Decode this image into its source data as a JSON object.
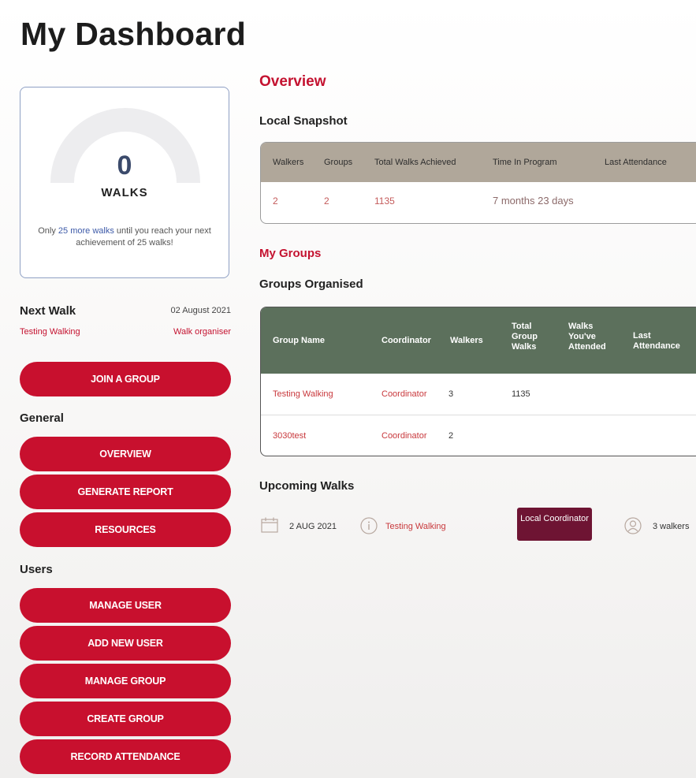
{
  "page": {
    "title": "My Dashboard"
  },
  "achievement": {
    "count": "0",
    "unit": "WALKS",
    "message_prefix": "Only ",
    "message_highlight": "25 more walks",
    "message_suffix": " until you reach your next achievement of 25 walks!",
    "progress": 0
  },
  "next_walk": {
    "title": "Next Walk",
    "date": "02 August 2021",
    "group": "Testing Walking",
    "role": "Walk organiser"
  },
  "sidebar": {
    "join_label": "JOIN A GROUP",
    "general_label": "General",
    "general_buttons": [
      "OVERVIEW",
      "GENERATE REPORT",
      "RESOURCES"
    ],
    "users_label": "Users",
    "users_buttons": [
      "MANAGE USER",
      "ADD NEW USER",
      "MANAGE GROUP",
      "CREATE GROUP",
      "RECORD ATTENDANCE"
    ]
  },
  "overview": {
    "title": "Overview",
    "snapshot_title": "Local Snapshot",
    "snapshot_headers": [
      "Walkers",
      "Groups",
      "Total Walks Achieved",
      "Time In Program",
      "Last Attendance"
    ],
    "snapshot_values": [
      "2",
      "2",
      "1135",
      "7 months 23 days",
      ""
    ]
  },
  "my_groups": {
    "title": "My Groups",
    "organised_title": "Groups Organised",
    "headers": [
      "Group Name",
      "Coordinator",
      "Walkers",
      "Total Group Walks",
      "Walks You've Attended",
      "Last Attendance"
    ],
    "rows": [
      [
        "Testing Walking",
        "Coordinator",
        "3",
        "1135",
        "",
        ""
      ],
      [
        "3030test",
        "Coordinator",
        "2",
        "",
        "",
        ""
      ]
    ]
  },
  "upcoming": {
    "title": "Upcoming Walks",
    "walks": [
      {
        "date": "2 AUG 2021",
        "name": "Testing Walking",
        "badge": "Local Coordinator",
        "walkers": "3 walkers"
      }
    ]
  },
  "colors": {
    "accent_red": "#c8102e",
    "header_green": "#5c705c",
    "header_taupe": "#b0a79a",
    "badge_maroon": "#6e1433"
  }
}
